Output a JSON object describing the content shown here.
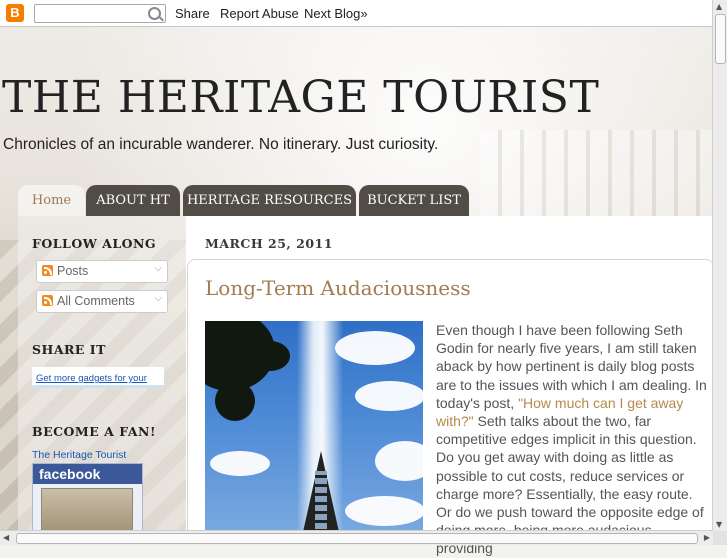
{
  "navbar": {
    "logo": "B",
    "search_placeholder": "",
    "share": "Share",
    "report_abuse": "Report Abuse",
    "next_blog": "Next Blog»"
  },
  "header": {
    "title": "THE HERITAGE TOURIST",
    "description": "Chronicles of an incurable wanderer. No itinerary. Just curiosity."
  },
  "tabs": [
    {
      "label": "Home",
      "active": true
    },
    {
      "label": "ABOUT HT",
      "active": false
    },
    {
      "label": "HERITAGE RESOURCES",
      "active": false
    },
    {
      "label": "BUCKET LIST",
      "active": false
    }
  ],
  "sidebar": {
    "follow_heading": "FOLLOW ALONG",
    "feeds": [
      "Posts",
      "All Comments"
    ],
    "share_heading": "SHARE IT",
    "gadget_link": "Get more gadgets for your",
    "fan_heading": "BECOME A FAN!",
    "fan_page_name": "The Heritage Tourist",
    "facebook_label": "facebook"
  },
  "post": {
    "date": "MARCH 25, 2011",
    "title": "Long-Term Audaciousness",
    "body_intro": "Even though I have been following Seth Godin for nearly five years, I am still taken aback by how pertinent is daily blog posts are to the issues with which I am dealing. In today's post, ",
    "link_text": "\"How much can I get away with?\"",
    "body_rest": " Seth talks about the two, far competitive edges implicit in this question. Do you get away with doing as little as possible to cut costs, reduce services or charge more? Essentially, the easy route. Or do we push toward the opposite edge of doing more, being more audacious, providing"
  },
  "colors": {
    "tab_bg": "#514c45",
    "tab_active_text": "#9c7a52",
    "post_title": "#a27c50",
    "link": "#b38a4a",
    "facebook_blue": "#3b5998"
  }
}
